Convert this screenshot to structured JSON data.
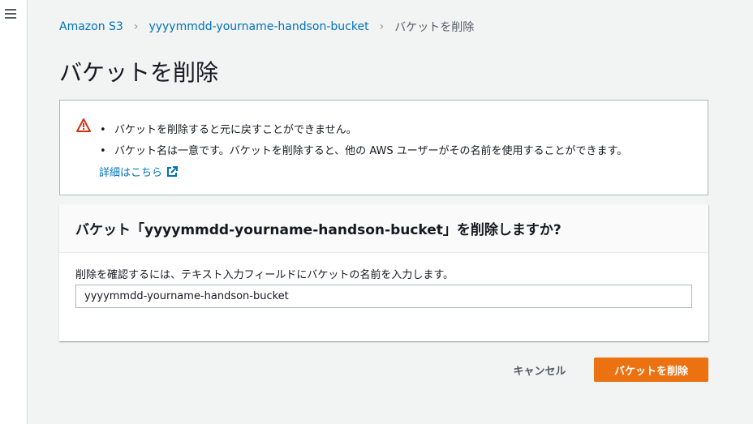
{
  "breadcrumb": {
    "items": [
      {
        "label": "Amazon S3"
      },
      {
        "label": "yyyymmdd-yourname-handson-bucket"
      }
    ],
    "current": "バケットを削除"
  },
  "page": {
    "title": "バケットを削除"
  },
  "alert": {
    "icon": "warning-icon",
    "color": "#d13212",
    "items": [
      "バケットを削除すると元に戻すことができません。",
      "バケット名は一意です。バケットを削除すると、他の AWS ユーザーがその名前を使用することができます。"
    ],
    "learn_more": "詳細はこちら"
  },
  "confirm_panel": {
    "title": "バケット「yyyymmdd-yourname-handson-bucket」を削除しますか?",
    "label": "削除を確認するには、テキスト入力フィールドにバケットの名前を入力します。",
    "input_value": "yyyymmdd-yourname-handson-bucket"
  },
  "actions": {
    "cancel": "キャンセル",
    "delete": "バケットを削除",
    "accent_color": "#ec7211"
  }
}
